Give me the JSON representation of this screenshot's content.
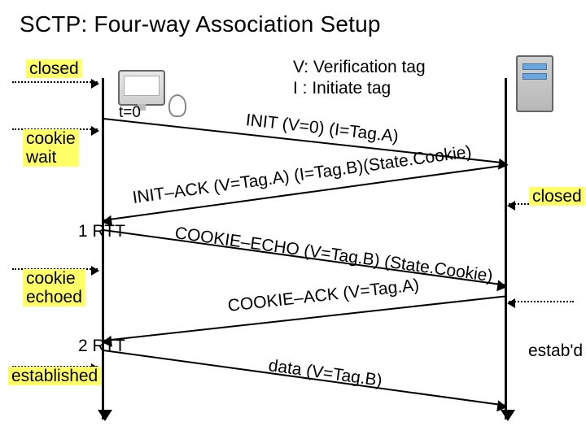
{
  "title": "SCTP: Four-way Association Setup",
  "legend": {
    "line1": "V: Verification tag",
    "line2": "I : Initiate tag"
  },
  "left_states": {
    "closed": "closed",
    "cookie_wait": "cookie\nwait",
    "rtt1": "1 RTT",
    "cookie_echoed": "cookie\nechoed",
    "rtt2": "2 RTT",
    "established": "established"
  },
  "right_states": {
    "closed": "closed",
    "estabd": "estab'd"
  },
  "time_marks": {
    "t0": "t=0"
  },
  "messages": {
    "init": "INIT (V=0) (I=Tag.A)",
    "init_ack": "INIT–ACK (V=Tag.A) (I=Tag.B)(State.Cookie)",
    "cookie_echo": "COOKIE–ECHO (V=Tag.B) (State.Cookie)",
    "cookie_ack": "COOKIE–ACK (V=Tag.A)",
    "data": "data (V=Tag.B)"
  }
}
